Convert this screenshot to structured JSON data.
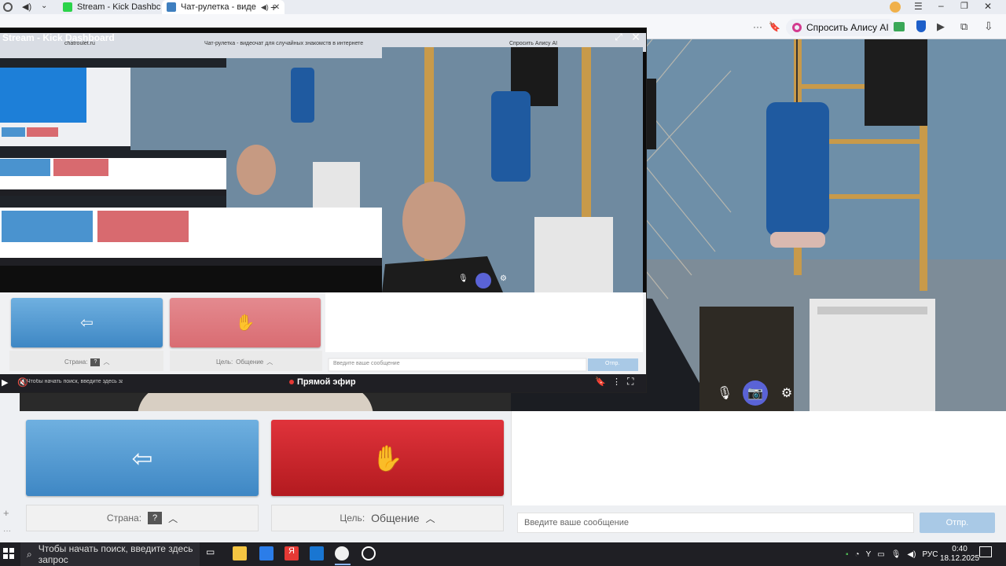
{
  "tabs": [
    {
      "label": "Stream - Kick Dashbc",
      "active": false
    },
    {
      "label": "Чат-рулетка - виде",
      "active": true
    }
  ],
  "browser": {
    "alice_label": "Спросить Алису AI"
  },
  "overlay": {
    "title": "Stream - Kick Dashboard",
    "live_label": "Прямой эфир",
    "inner_title": "Чат-рулетка - видеочат для случайных знакомств в интернете",
    "inner_url": "chatroulet.ru",
    "inner_alice": "Спросить Алису AI",
    "inner_search": "Чтобы начать поиск, введите здесь запрос"
  },
  "page": {
    "country_label": "Страна:",
    "country_value": "?",
    "goal_label": "Цель:",
    "goal_value": "Общение",
    "message_placeholder": "Введите ваше сообщение",
    "send_label": "Отпр."
  },
  "taskbar": {
    "search_placeholder": "Чтобы начать поиск, введите здесь запрос",
    "lang": "РУС",
    "time": "0:40",
    "date": "18.12.2025"
  },
  "colors": {
    "blue_button": "#4a93cf",
    "red_button": "#c8232a",
    "send_button": "#a9c9e6",
    "taskbar": "#1f1f24"
  }
}
